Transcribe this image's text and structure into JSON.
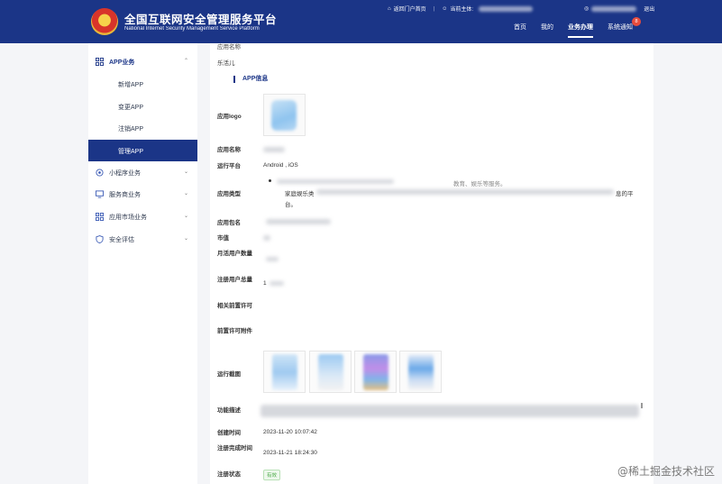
{
  "header": {
    "title_cn": "全国互联网安全管理服务平台",
    "title_en": "National Internet Security Management Service Platform",
    "portal_link": "返回门户首页",
    "current_subject_label": "当前主体:",
    "logout": "退出",
    "nav": [
      {
        "label": "首页",
        "active": false
      },
      {
        "label": "我的",
        "active": false
      },
      {
        "label": "业务办理",
        "active": true
      },
      {
        "label": "系统通知",
        "active": false,
        "badge": "8"
      }
    ]
  },
  "sidebar": {
    "groups": [
      {
        "label": "APP业务",
        "icon": "grid-icon",
        "open": true,
        "items": [
          {
            "label": "新增APP",
            "active": false
          },
          {
            "label": "变更APP",
            "active": false
          },
          {
            "label": "注销APP",
            "active": false
          },
          {
            "label": "管理APP",
            "active": true
          }
        ]
      },
      {
        "label": "小程序业务",
        "icon": "mini-program-icon",
        "open": false
      },
      {
        "label": "服务商业务",
        "icon": "monitor-icon",
        "open": false
      },
      {
        "label": "应用市场业务",
        "icon": "grid-icon",
        "open": false
      },
      {
        "label": "安全评估",
        "icon": "shield-icon",
        "open": false
      }
    ]
  },
  "content": {
    "app_name_top_label": "应用名称",
    "app_name_top_value": "乐活儿",
    "section_title": "APP信息",
    "rows": {
      "logo": "应用logo",
      "name": "应用名称",
      "platform": "运行平台",
      "platform_value": "Android , iOS",
      "type": "应用类型",
      "type_text_1": "教育、娱乐等服务。",
      "type_text_2": "家庭娱乐类",
      "type_text_3": "台。",
      "type_text_4": "息的平",
      "package": "应用包名",
      "market_value": "市值",
      "mau": "月活用户数量",
      "registered": "注册用户总量",
      "registered_value": "1",
      "pre_license": "相关前置许可",
      "pre_license_attach": "前置许可附件",
      "screenshots": "运行截图",
      "description": "功能描述",
      "created": "创建时间",
      "created_value": "2023-11-20 10:07:42",
      "reg_done": "注册完成时间",
      "reg_done_value": "2023-11-21 18:24:30",
      "reg_status": "注册状态",
      "reg_status_value": "有效"
    }
  },
  "watermark": "@稀土掘金技术社区",
  "colors": {
    "primary": "#1b3587",
    "background": "#f4f5f8",
    "status_green": "#4caa48",
    "badge_red": "#e84c3d"
  }
}
